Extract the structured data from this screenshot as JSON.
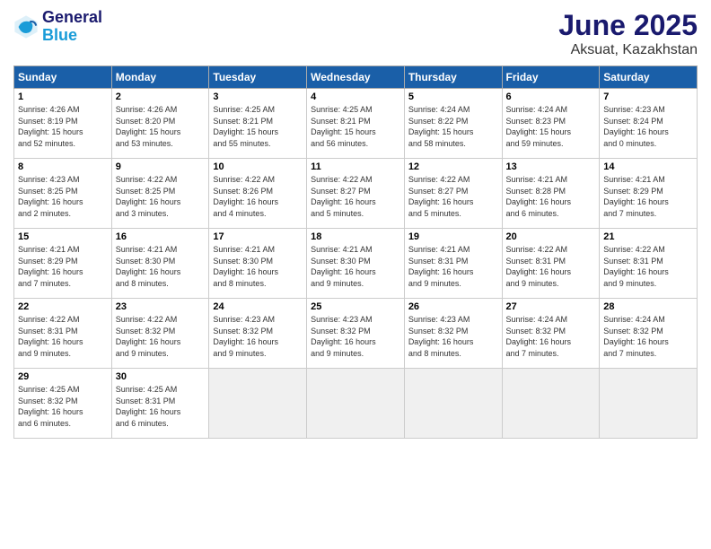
{
  "logo": {
    "text_general": "General",
    "text_blue": "Blue"
  },
  "title": "June 2025",
  "subtitle": "Aksuat, Kazakhstan",
  "headers": [
    "Sunday",
    "Monday",
    "Tuesday",
    "Wednesday",
    "Thursday",
    "Friday",
    "Saturday"
  ],
  "weeks": [
    [
      {
        "day": "1",
        "sunrise": "4:26 AM",
        "sunset": "8:19 PM",
        "daylight": "15 hours and 52 minutes."
      },
      {
        "day": "2",
        "sunrise": "4:26 AM",
        "sunset": "8:20 PM",
        "daylight": "15 hours and 53 minutes."
      },
      {
        "day": "3",
        "sunrise": "4:25 AM",
        "sunset": "8:21 PM",
        "daylight": "15 hours and 55 minutes."
      },
      {
        "day": "4",
        "sunrise": "4:25 AM",
        "sunset": "8:21 PM",
        "daylight": "15 hours and 56 minutes."
      },
      {
        "day": "5",
        "sunrise": "4:24 AM",
        "sunset": "8:22 PM",
        "daylight": "15 hours and 58 minutes."
      },
      {
        "day": "6",
        "sunrise": "4:24 AM",
        "sunset": "8:23 PM",
        "daylight": "15 hours and 59 minutes."
      },
      {
        "day": "7",
        "sunrise": "4:23 AM",
        "sunset": "8:24 PM",
        "daylight": "16 hours and 0 minutes."
      }
    ],
    [
      {
        "day": "8",
        "sunrise": "4:23 AM",
        "sunset": "8:25 PM",
        "daylight": "16 hours and 2 minutes."
      },
      {
        "day": "9",
        "sunrise": "4:22 AM",
        "sunset": "8:25 PM",
        "daylight": "16 hours and 3 minutes."
      },
      {
        "day": "10",
        "sunrise": "4:22 AM",
        "sunset": "8:26 PM",
        "daylight": "16 hours and 4 minutes."
      },
      {
        "day": "11",
        "sunrise": "4:22 AM",
        "sunset": "8:27 PM",
        "daylight": "16 hours and 5 minutes."
      },
      {
        "day": "12",
        "sunrise": "4:22 AM",
        "sunset": "8:27 PM",
        "daylight": "16 hours and 5 minutes."
      },
      {
        "day": "13",
        "sunrise": "4:21 AM",
        "sunset": "8:28 PM",
        "daylight": "16 hours and 6 minutes."
      },
      {
        "day": "14",
        "sunrise": "4:21 AM",
        "sunset": "8:29 PM",
        "daylight": "16 hours and 7 minutes."
      }
    ],
    [
      {
        "day": "15",
        "sunrise": "4:21 AM",
        "sunset": "8:29 PM",
        "daylight": "16 hours and 7 minutes."
      },
      {
        "day": "16",
        "sunrise": "4:21 AM",
        "sunset": "8:30 PM",
        "daylight": "16 hours and 8 minutes."
      },
      {
        "day": "17",
        "sunrise": "4:21 AM",
        "sunset": "8:30 PM",
        "daylight": "16 hours and 8 minutes."
      },
      {
        "day": "18",
        "sunrise": "4:21 AM",
        "sunset": "8:30 PM",
        "daylight": "16 hours and 9 minutes."
      },
      {
        "day": "19",
        "sunrise": "4:21 AM",
        "sunset": "8:31 PM",
        "daylight": "16 hours and 9 minutes."
      },
      {
        "day": "20",
        "sunrise": "4:22 AM",
        "sunset": "8:31 PM",
        "daylight": "16 hours and 9 minutes."
      },
      {
        "day": "21",
        "sunrise": "4:22 AM",
        "sunset": "8:31 PM",
        "daylight": "16 hours and 9 minutes."
      }
    ],
    [
      {
        "day": "22",
        "sunrise": "4:22 AM",
        "sunset": "8:31 PM",
        "daylight": "16 hours and 9 minutes."
      },
      {
        "day": "23",
        "sunrise": "4:22 AM",
        "sunset": "8:32 PM",
        "daylight": "16 hours and 9 minutes."
      },
      {
        "day": "24",
        "sunrise": "4:23 AM",
        "sunset": "8:32 PM",
        "daylight": "16 hours and 9 minutes."
      },
      {
        "day": "25",
        "sunrise": "4:23 AM",
        "sunset": "8:32 PM",
        "daylight": "16 hours and 9 minutes."
      },
      {
        "day": "26",
        "sunrise": "4:23 AM",
        "sunset": "8:32 PM",
        "daylight": "16 hours and 8 minutes."
      },
      {
        "day": "27",
        "sunrise": "4:24 AM",
        "sunset": "8:32 PM",
        "daylight": "16 hours and 7 minutes."
      },
      {
        "day": "28",
        "sunrise": "4:24 AM",
        "sunset": "8:32 PM",
        "daylight": "16 hours and 7 minutes."
      }
    ],
    [
      {
        "day": "29",
        "sunrise": "4:25 AM",
        "sunset": "8:32 PM",
        "daylight": "16 hours and 6 minutes."
      },
      {
        "day": "30",
        "sunrise": "4:25 AM",
        "sunset": "8:31 PM",
        "daylight": "16 hours and 6 minutes."
      },
      null,
      null,
      null,
      null,
      null
    ]
  ]
}
